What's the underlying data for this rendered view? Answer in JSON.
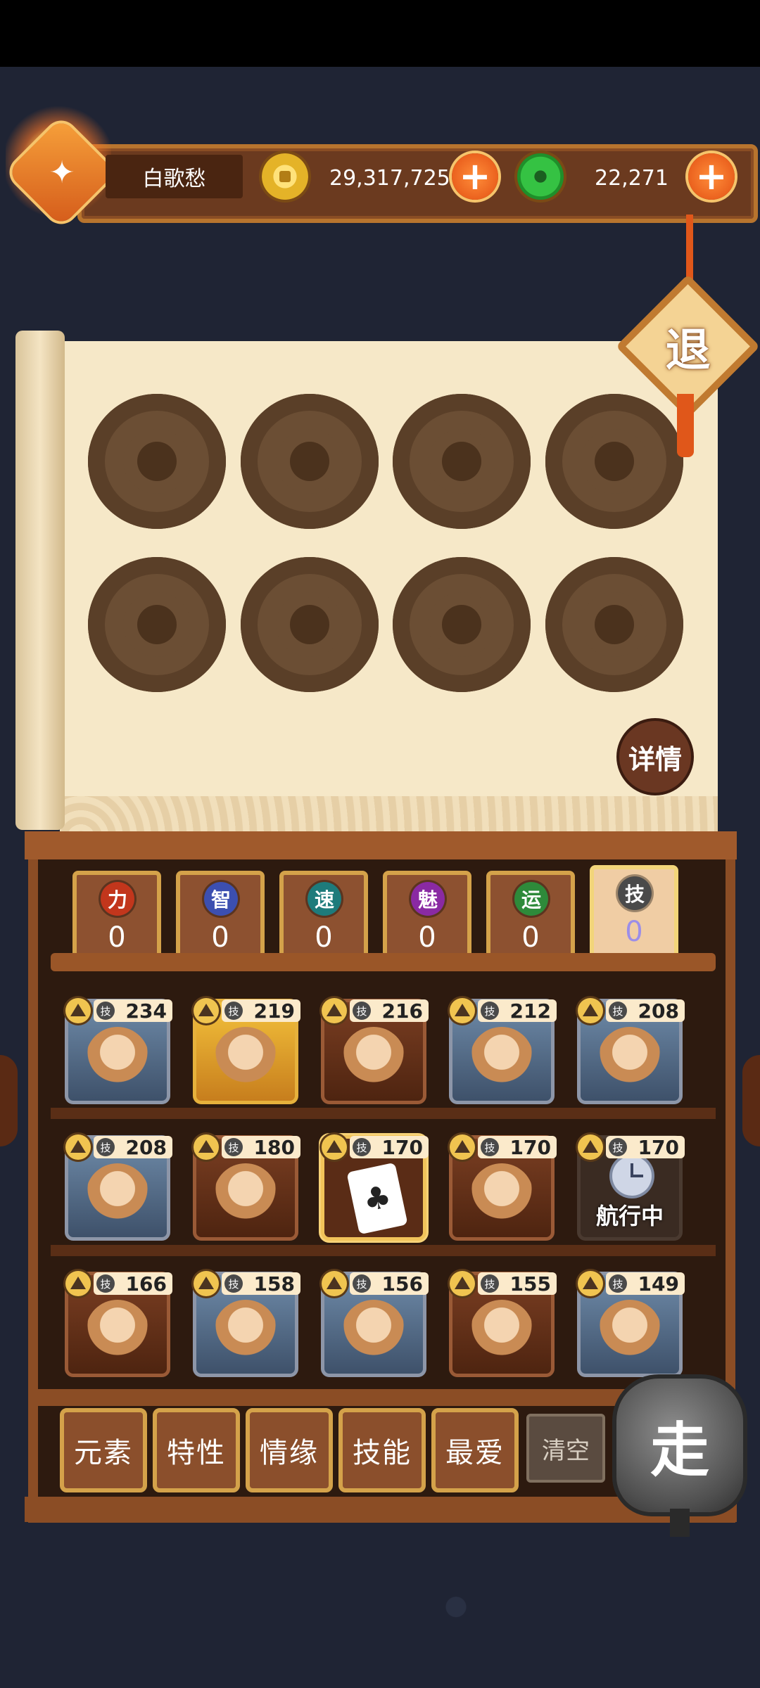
{
  "player": {
    "name": "白歌愁",
    "avatar_icon": "fox-mask-icon"
  },
  "currency": {
    "coins": "29,317,725",
    "jade": "22,271",
    "plus_label": "+"
  },
  "exit_label": "退",
  "detail_label": "详情",
  "stats": [
    {
      "key": "力",
      "value": "0",
      "color": "#c2361c"
    },
    {
      "key": "智",
      "value": "0",
      "color": "#3c4fb0"
    },
    {
      "key": "速",
      "value": "0",
      "color": "#1e7b7b"
    },
    {
      "key": "魅",
      "value": "0",
      "color": "#8a2aa3"
    },
    {
      "key": "运",
      "value": "0",
      "color": "#2e8a3a"
    },
    {
      "key": "技",
      "value": "0",
      "color": "#4a4a4a"
    }
  ],
  "skill_badge_label": "技",
  "heroes": [
    {
      "skill": "234",
      "style": "silver"
    },
    {
      "skill": "219",
      "style": "gold"
    },
    {
      "skill": "216",
      "style": "brown"
    },
    {
      "skill": "212",
      "style": "silver"
    },
    {
      "skill": "208",
      "style": "silver"
    },
    {
      "skill": "208",
      "style": "silver"
    },
    {
      "skill": "180",
      "style": "brown"
    },
    {
      "skill": "170",
      "style": "selected",
      "icon": "♣"
    },
    {
      "skill": "170",
      "style": "brown"
    },
    {
      "skill": "170",
      "style": "dark",
      "status": "航行中"
    },
    {
      "skill": "166",
      "style": "brown"
    },
    {
      "skill": "158",
      "style": "silver"
    },
    {
      "skill": "156",
      "style": "silver"
    },
    {
      "skill": "155",
      "style": "brown"
    },
    {
      "skill": "149",
      "style": "silver"
    }
  ],
  "filters": [
    "元素",
    "特性",
    "情缘",
    "技能",
    "最爱"
  ],
  "clear_label": "清空",
  "go_label": "走"
}
